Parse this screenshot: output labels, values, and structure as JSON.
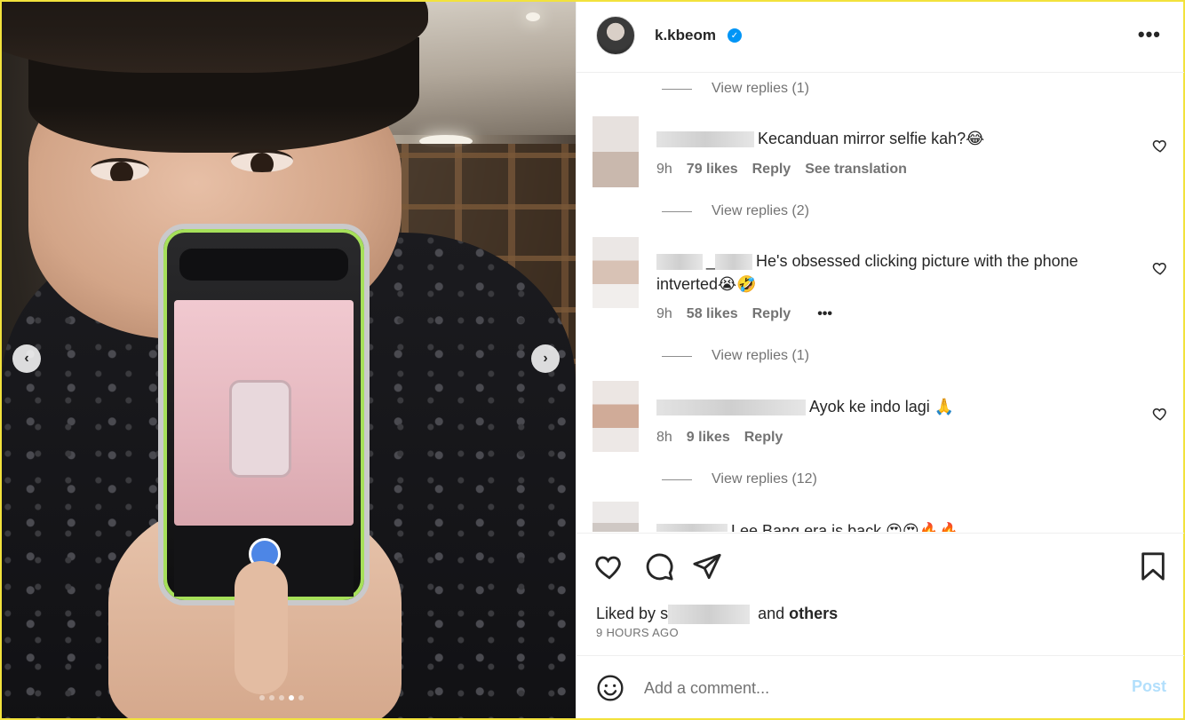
{
  "post": {
    "username": "k.kbeom",
    "verified_mark": "✓",
    "more_label": "•••",
    "carousel": {
      "prev_glyph": "‹",
      "next_glyph": "›",
      "dot_count": 5,
      "active_dot": 4
    }
  },
  "comments": [
    {
      "replies_label": "View replies (1)"
    },
    {
      "username_visible": "",
      "text": "Kecanduan mirror selfie kah?",
      "emoji": "😂",
      "time": "9h",
      "likes": "79 likes",
      "reply": "Reply",
      "extra": "See translation",
      "replies_label": "View replies (2)"
    },
    {
      "username_visible": "_",
      "text": "He's obsessed clicking picture with the phone intverted",
      "emoji": "😭🤣",
      "time": "9h",
      "likes": "58 likes",
      "reply": "Reply",
      "extra": "•••",
      "replies_label": "View replies (1)"
    },
    {
      "username_visible": "",
      "text": "Ayok ke indo lagi",
      "emoji": "🙏",
      "time": "8h",
      "likes": "9 likes",
      "reply": "Reply",
      "replies_label": "View replies (12)"
    },
    {
      "username_visible": "",
      "text": "Lee Bang era is back",
      "emoji": "😍😍🔥🔥"
    }
  ],
  "liked_by": {
    "prefix": "Liked by",
    "initial": "s",
    "conj": "and",
    "others": "others"
  },
  "time_ago": "9 HOURS AGO",
  "composer": {
    "placeholder": "Add a comment...",
    "post_label": "Post"
  },
  "colors": {
    "verified": "#0095f6",
    "post_disabled": "#b2dffc",
    "frame": "#f2e23c"
  },
  "icons": [
    "heart-icon",
    "comment-icon",
    "share-icon",
    "bookmark-icon",
    "emoji-icon",
    "more-icon",
    "chevron-left-icon",
    "chevron-right-icon"
  ]
}
